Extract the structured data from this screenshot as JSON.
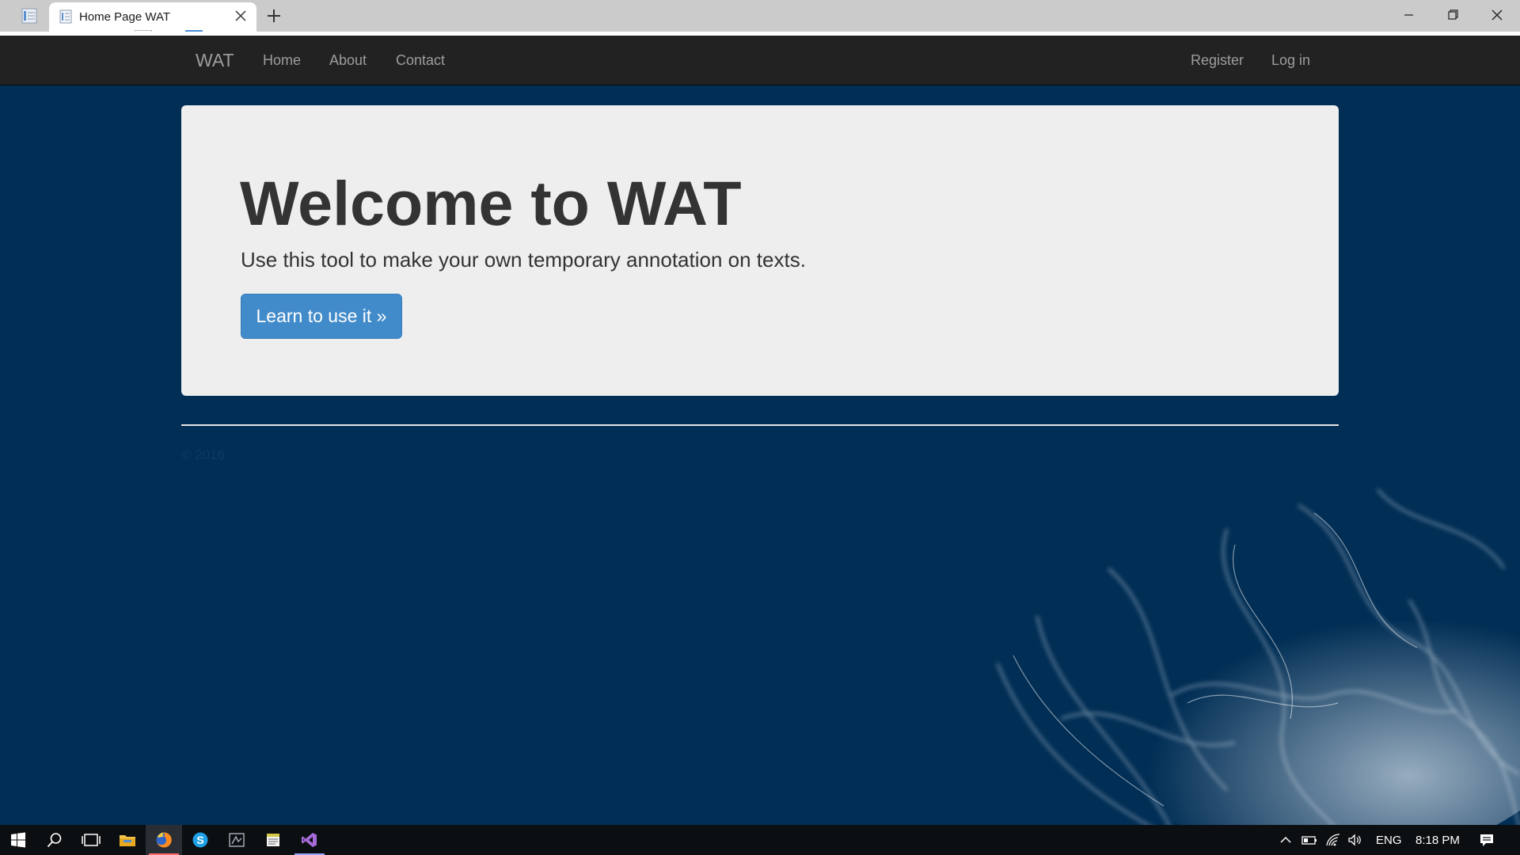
{
  "browser": {
    "tab": {
      "title": "Home Page WAT",
      "favicon": "page-icon"
    },
    "controls": {
      "new_tab_icon": "plus-icon",
      "minimize_icon": "minimize-icon",
      "restore_icon": "restore-icon",
      "close_icon": "close-icon"
    }
  },
  "navbar": {
    "brand": "WAT",
    "left_links": [
      "Home",
      "About",
      "Contact"
    ],
    "right_links": [
      "Register",
      "Log in"
    ]
  },
  "jumbotron": {
    "title": "Welcome to WAT",
    "lead": "Use this tool to make your own temporary annotation on texts.",
    "button_label": "Learn to use it »"
  },
  "footer": {
    "copyright": "© 2016"
  },
  "taskbar": {
    "apps": [
      "start-icon",
      "search-icon",
      "task-view-icon",
      "file-explorer-icon",
      "firefox-icon",
      "skype-icon",
      "app-icon",
      "notepad-icon",
      "visual-studio-icon"
    ],
    "tray": {
      "language": "ENG",
      "time": "8:18 PM"
    }
  },
  "colors": {
    "navbar": "#222222",
    "background": "#012e55",
    "jumbotron": "#eeeeee",
    "primary_button": "#428bca"
  }
}
